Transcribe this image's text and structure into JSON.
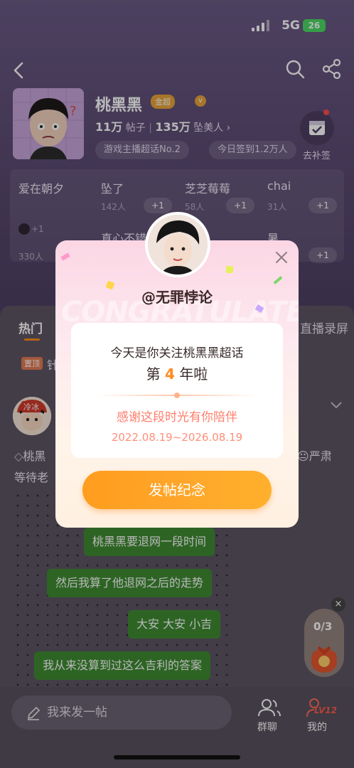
{
  "status_bar": {
    "network": "5G",
    "battery": "26"
  },
  "profile": {
    "name": "桃黑黑",
    "badge": "金超",
    "posts_count": "11万",
    "posts_label": "帖子",
    "fans_count": "135万",
    "fans_label": "坠美人",
    "tags": [
      "游戏主播超话No.2",
      "今日签到1.2万人"
    ],
    "sign_label": "去补签"
  },
  "ranking": {
    "first": {
      "name": "爱在朝夕",
      "plus": "+1",
      "count": "330人"
    },
    "cells": [
      {
        "name": "坠了",
        "count": "142人",
        "plus": "+1"
      },
      {
        "name": "芝芝莓莓",
        "count": "58人",
        "plus": "+1"
      },
      {
        "name": "chai",
        "count": "31人",
        "plus": "+1"
      },
      {
        "name": "真心不错",
        "count": "",
        "plus": ""
      },
      {
        "name": "暑",
        "count": "",
        "plus": "+1"
      }
    ]
  },
  "feed": {
    "tab_hot": "热门",
    "tab_live": "直播录屏",
    "pin_label": "置顶",
    "pin_text": "针",
    "avatar_label": "冷冰",
    "post_line1_prefix": "桃黑",
    "post_line1_suffix": "严肃",
    "post_line2": "等待老",
    "chat": [
      "桃黑黑要退网一段时间",
      "然后我算了他退网之后的走势",
      "大安 大安 小吉",
      "我从来没算到过这么吉利的答案"
    ],
    "task_progress": "0/3"
  },
  "bottom_bar": {
    "compose_placeholder": "我来发一帖",
    "group_chat": "群聊",
    "mine": "我的",
    "level": "LV12"
  },
  "modal": {
    "banner_text": "CONGRATULATE",
    "handle": "@无罪悖论",
    "line1": "今天是你关注桃黑黑超话",
    "line2_prefix": "第",
    "years": "4",
    "line2_suffix": "年啦",
    "line3": "感谢这段时光有你陪伴",
    "date_range": "2022.08.19~2026.08.19",
    "cta": "发帖纪念"
  },
  "colors": {
    "accent": "#ff9d1e",
    "modal_pink": "#fbd6e4",
    "chat_green": "#3f8b32"
  }
}
